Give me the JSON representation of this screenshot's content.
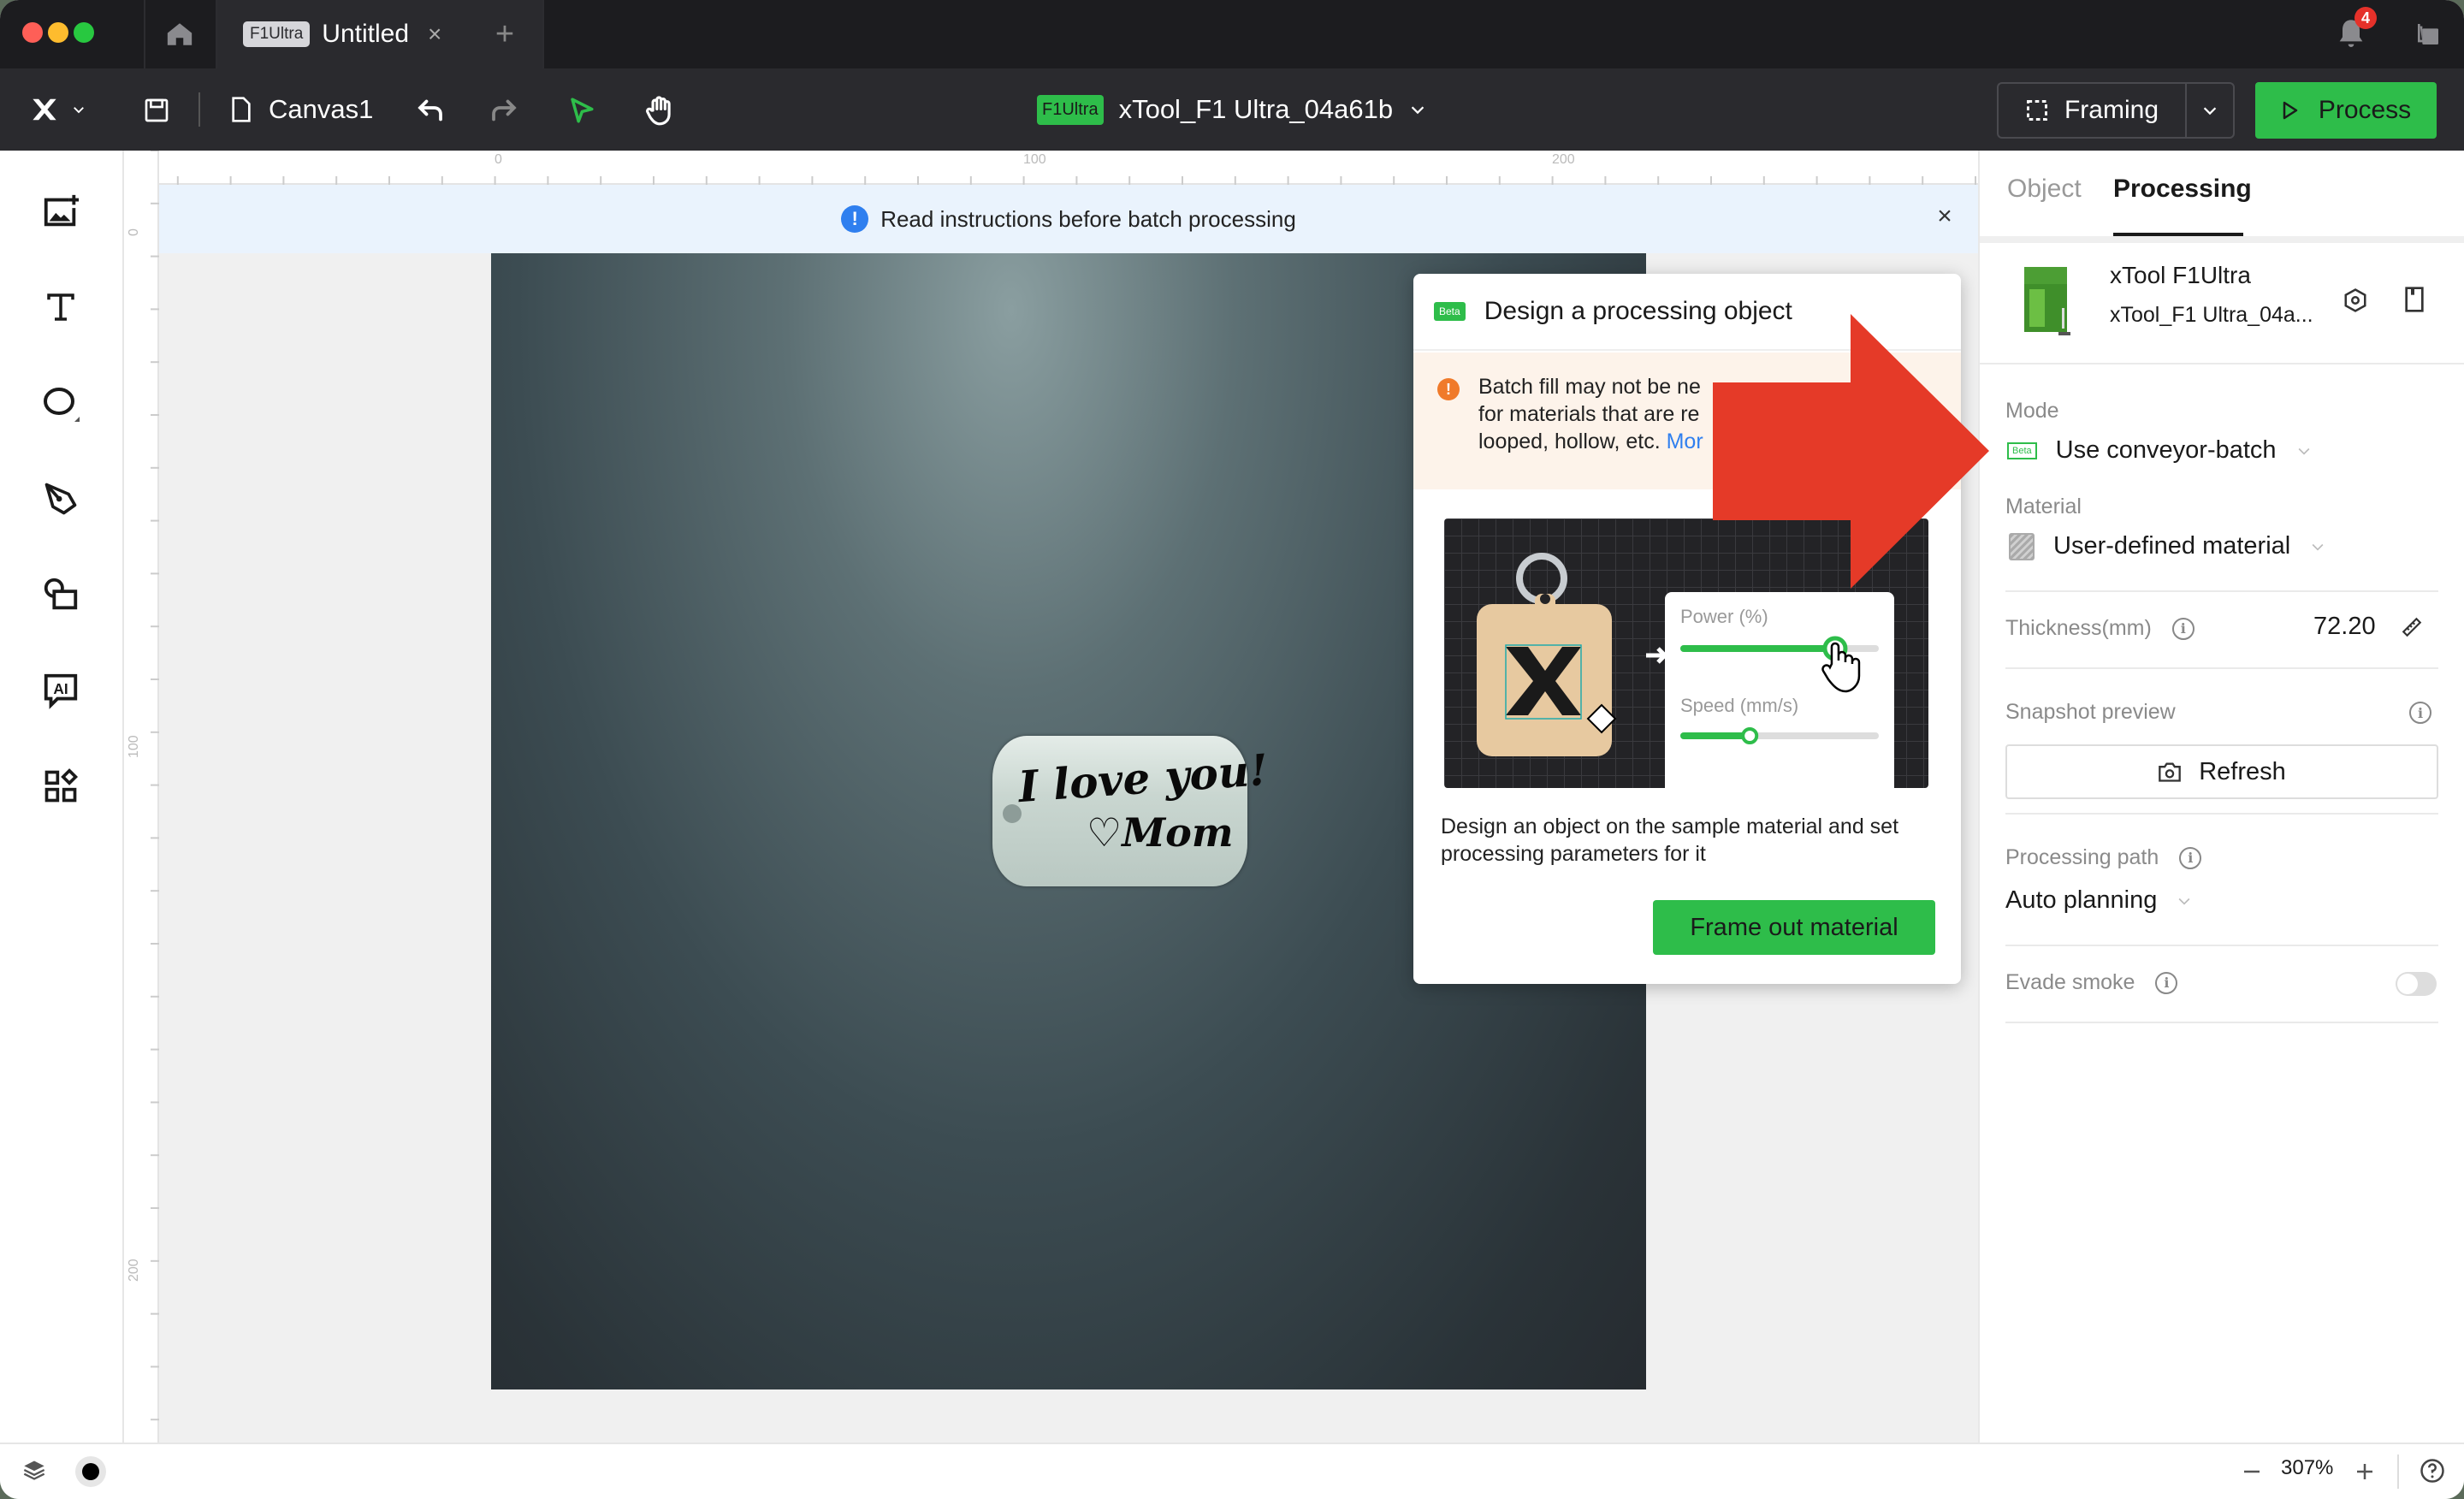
{
  "titlebar": {
    "tab_badge": "F1Ultra",
    "tab_title": "Untitled",
    "tab_close": "×",
    "new_tab": "+",
    "notification_count": "4"
  },
  "toolbar": {
    "canvas_name": "Canvas1",
    "device_badge": "F1Ultra",
    "device_name": "xTool_F1 Ultra_04a61b",
    "framing_label": "Framing",
    "process_label": "Process"
  },
  "left_tools": [
    {
      "name": "add-image",
      "icon": "image-plus-icon"
    },
    {
      "name": "text",
      "icon": "text-icon"
    },
    {
      "name": "shape",
      "icon": "circle-icon"
    },
    {
      "name": "pen",
      "icon": "pen-icon"
    },
    {
      "name": "shapes-library",
      "icon": "shapes-icon"
    },
    {
      "name": "ai",
      "icon": "ai-chat-icon"
    },
    {
      "name": "apps",
      "icon": "apps-icon"
    }
  ],
  "rulers": {
    "top_labels": [
      "0",
      "100",
      "200"
    ],
    "left_labels": [
      "0",
      "100",
      "200"
    ]
  },
  "notice": {
    "text": "Read instructions before batch processing",
    "close": "×"
  },
  "canvas_object": {
    "line1": "I love you!",
    "line2": "♡Mom"
  },
  "popup": {
    "beta": "Beta",
    "title": "Design a processing object",
    "warning_visible": "Batch fill may not be ne",
    "warning_line2": "for materials that are re",
    "warning_line3": "looped, hollow, etc.",
    "more_link": "Mor",
    "illus_power_label": "Power (%)",
    "illus_speed_label": "Speed (mm/s)",
    "illus_power_value": 0.78,
    "illus_speed_value": 0.35,
    "description": "Design an object on the sample material and set processing parameters for it",
    "frame_button": "Frame out material"
  },
  "right_panel": {
    "tabs": [
      {
        "label": "Object",
        "active": false
      },
      {
        "label": "Processing",
        "active": true
      }
    ],
    "device_title": "xTool F1Ultra",
    "device_subtitle": "xTool_F1 Ultra_04a...",
    "mode_label": "Mode",
    "mode_beta": "Beta",
    "mode_value": "Use conveyor-batch",
    "material_label": "Material",
    "material_value": "User-defined material",
    "thickness_label": "Thickness(mm)",
    "thickness_value": "72.20",
    "snapshot_label": "Snapshot preview",
    "refresh_label": "Refresh",
    "path_label": "Processing path",
    "path_value": "Auto planning",
    "evade_label": "Evade smoke",
    "evade_on": false
  },
  "statusbar": {
    "zoom": "307%"
  },
  "colors": {
    "accent_green": "#2ebd4a",
    "annotation_red": "#e53a28",
    "info_blue": "#2f7fef",
    "warning_orange": "#f07a2a"
  }
}
